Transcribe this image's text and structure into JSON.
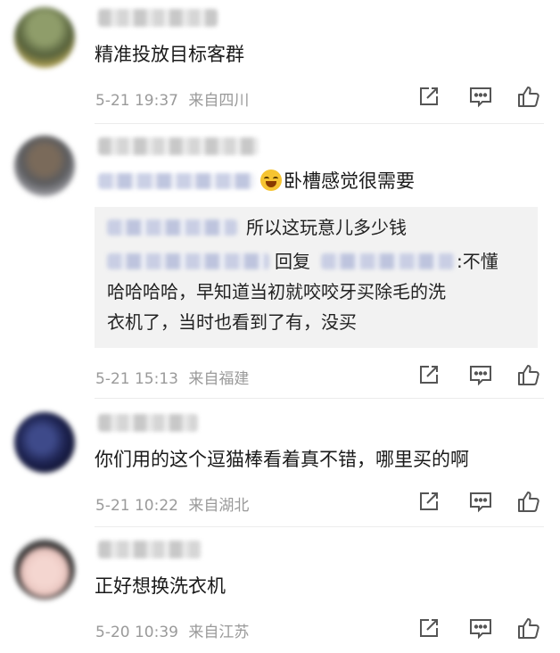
{
  "comments": [
    {
      "text": "精准投放目标客群",
      "date": "5-21 19:37",
      "location": "来自四川"
    },
    {
      "text": "卧槽感觉很需要",
      "date": "5-21 15:13",
      "location": "来自福建",
      "reply_quote": {
        "line1": "所以这玩意儿多少钱",
        "reply_word": "回复",
        "reply_suffix": ":不懂",
        "line3": "哈哈哈哈，早知道当初就咬咬牙买除毛的洗",
        "line4": "衣机了，当时也看到了有，没买"
      }
    },
    {
      "text": "你们用的这个逗猫棒看着真不错，哪里买的啊",
      "date": "5-21 10:22",
      "location": "来自湖北"
    },
    {
      "text": "正好想换洗衣机",
      "date": "5-20 10:39",
      "location": "来自江苏"
    }
  ],
  "icons": {
    "share": "share-icon",
    "comment": "comment-icon",
    "like": "thumbs-up-icon"
  },
  "colors": {
    "meta_text": "#9a9a9a",
    "quote_bg": "#f2f2f2",
    "icon": "#555555"
  }
}
